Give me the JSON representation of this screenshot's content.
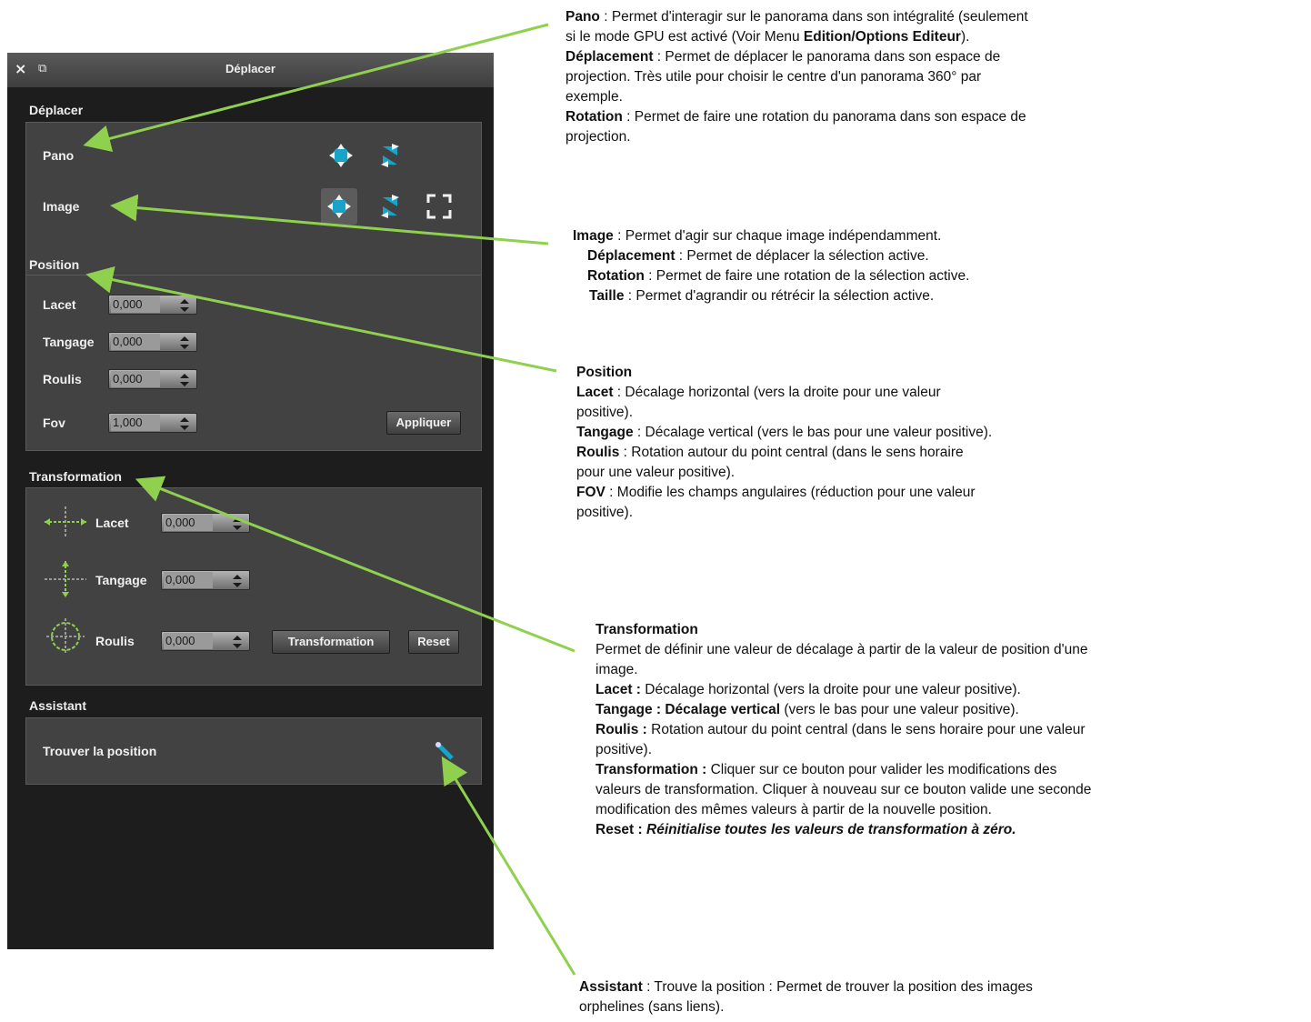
{
  "window": {
    "title": "Déplacer",
    "close_glyph": "×",
    "float_glyph": "⧉"
  },
  "sections": {
    "deplacer": {
      "title": "Déplacer",
      "pano_label": "Pano",
      "image_label": "Image",
      "icons": [
        "move-icon",
        "rotate-icon",
        "resize-icon"
      ]
    },
    "position": {
      "title": "Position",
      "fields": [
        {
          "label": "Lacet",
          "value": "0,000"
        },
        {
          "label": "Tangage",
          "value": "0,000"
        },
        {
          "label": "Roulis",
          "value": "0,000"
        },
        {
          "label": "Fov",
          "value": "1,000"
        }
      ],
      "apply_label": "Appliquer"
    },
    "transformation": {
      "title": "Transformation",
      "fields": [
        {
          "label": "Lacet",
          "value": "0,000"
        },
        {
          "label": "Tangage",
          "value": "0,000"
        },
        {
          "label": "Roulis",
          "value": "0,000"
        }
      ],
      "transform_label": "Transformation",
      "reset_label": "Reset"
    },
    "assistant": {
      "title": "Assistant",
      "find_label": "Trouver la position"
    }
  },
  "annotations": {
    "pano": {
      "l1_b": "Pano",
      "l1": " : Permet d'interagir sur le panorama dans son intégralité (seulement",
      "l2": "si le mode GPU est activé (Voir Menu ",
      "l2_b": "Edition/Options Editeur",
      "l2_end": ").",
      "l3_b": "Déplacement",
      "l3": " : Permet de déplacer le panorama dans son espace de",
      "l4": "projection. Très utile pour choisir le centre d'un panorama 360° par",
      "l5": "exemple.",
      "l6_b": "Rotation",
      "l6": " : Permet de faire une rotation du panorama dans son espace de",
      "l7": "projection."
    },
    "image": {
      "l1_b": "Image",
      "l1": " : Permet d'agir sur chaque image indépendamment.",
      "l2_b": "Déplacement",
      "l2": " : Permet de déplacer la sélection active.",
      "l3_b": "Rotation",
      "l3": " : Permet de faire une rotation de la sélection active.",
      "l4_b": "Taille",
      "l4": " : Permet d'agrandir ou rétrécir la sélection active."
    },
    "position": {
      "title": "Position",
      "l1_b": "Lacet",
      "l1": " : Décalage horizontal (vers la droite pour une valeur",
      "l2": "positive).",
      "l3_b": "Tangage",
      "l3": " : Décalage vertical (vers le bas pour une valeur positive).",
      "l4_b": "Roulis",
      "l4": " : Rotation autour du point central (dans le sens horaire",
      "l5": "pour une valeur positive).",
      "l6_b": "FOV",
      "l6": " : Modifie les champs angulaires (réduction pour une valeur",
      "l7": "positive)."
    },
    "transformation": {
      "title": "Transformation",
      "l1": "Permet de définir une valeur de décalage à partir de la valeur de position d'une",
      "l2": "image.",
      "l3_b": "Lacet :",
      "l3": " Décalage horizontal (vers la droite pour une valeur positive).",
      "l4_b": "Tangage : Décalage vertical",
      "l4": " (vers le bas pour une valeur positive).",
      "l5_b": "Roulis :",
      "l5": " Rotation autour du point central (dans le sens horaire pour une valeur",
      "l6": "positive).",
      "l7_b": "Transformation :",
      "l7": " Cliquer sur ce bouton pour valider les modifications des",
      "l8": "valeurs de transformation. Cliquer à nouveau sur ce bouton valide une seconde",
      "l9": "modification des mêmes valeurs à partir de la nouvelle position.",
      "l10_b": "Reset :",
      "l10_i": "Réinitialise toutes les valeurs de transformation à zéro."
    },
    "assistant": {
      "l1_b": "Assistant",
      "l1": " : Trouve la position : Permet de trouver la position des images",
      "l2": "orphelines (sans liens)."
    }
  },
  "colors": {
    "arrow": "#8fd14f",
    "accent_icon": "#1aa3c8"
  }
}
